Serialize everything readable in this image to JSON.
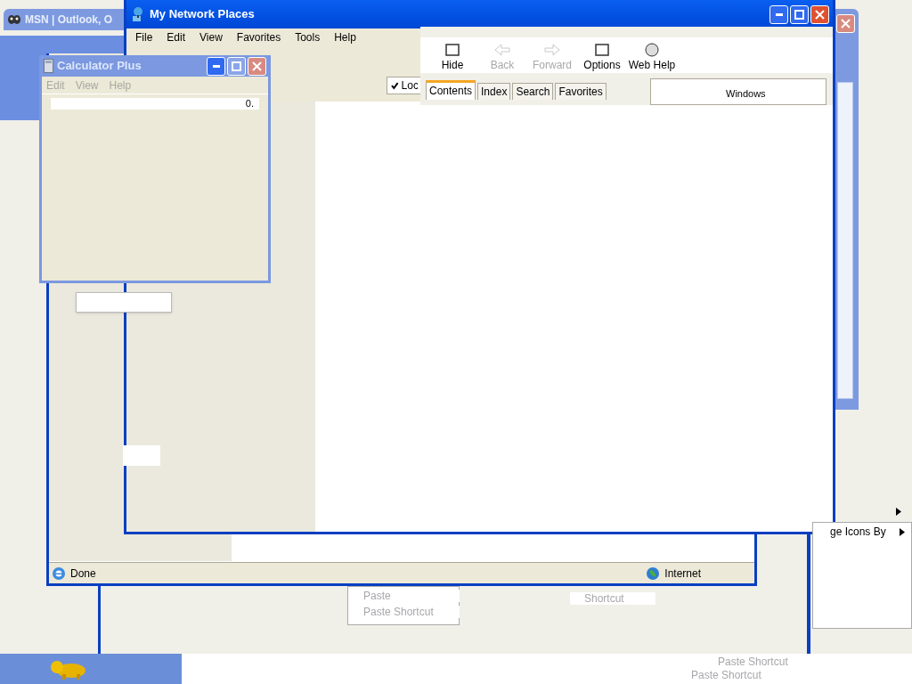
{
  "msn_window": {
    "title": "MSN | Outlook, O"
  },
  "network_window": {
    "title": "My Network Places",
    "menu": [
      "File",
      "Edit",
      "View",
      "Favorites",
      "Tools",
      "Help"
    ],
    "checkbox": {
      "label": "Loc",
      "checked": true
    }
  },
  "help_window": {
    "toolbar": [
      {
        "label": "Hide",
        "disabled": false
      },
      {
        "label": "Back",
        "disabled": true
      },
      {
        "label": "Forward",
        "disabled": true
      },
      {
        "label": "Options",
        "disabled": false
      },
      {
        "label": "Web Help",
        "disabled": false
      }
    ],
    "tabs": [
      {
        "label": "Contents",
        "selected": true
      },
      {
        "label": "Index",
        "selected": false
      },
      {
        "label": "Search",
        "selected": false
      },
      {
        "label": "Favorites",
        "selected": false
      }
    ],
    "logo_text": "Windows"
  },
  "calculator": {
    "title": "Calculator Plus",
    "menu": [
      {
        "label": "Edit",
        "disabled": true
      },
      {
        "label": "View",
        "disabled": true
      },
      {
        "label": "Help",
        "disabled": true
      }
    ],
    "display": "0."
  },
  "browser_window": {
    "status": "Done",
    "zone": "Internet"
  },
  "menu_fragments": [
    {
      "label": "Paste",
      "disabled": true,
      "submenu": false
    },
    {
      "label": "Paste Shortcut",
      "disabled": true,
      "submenu": false
    },
    {
      "label": "Shortcut",
      "disabled": true,
      "submenu": false
    },
    {
      "label": "ge Icons By",
      "disabled": false,
      "submenu": true
    },
    {
      "label": "Paste Shortcut",
      "disabled": true,
      "submenu": false
    },
    {
      "label": "Paste Shortcut",
      "disabled": true,
      "submenu": false
    }
  ]
}
